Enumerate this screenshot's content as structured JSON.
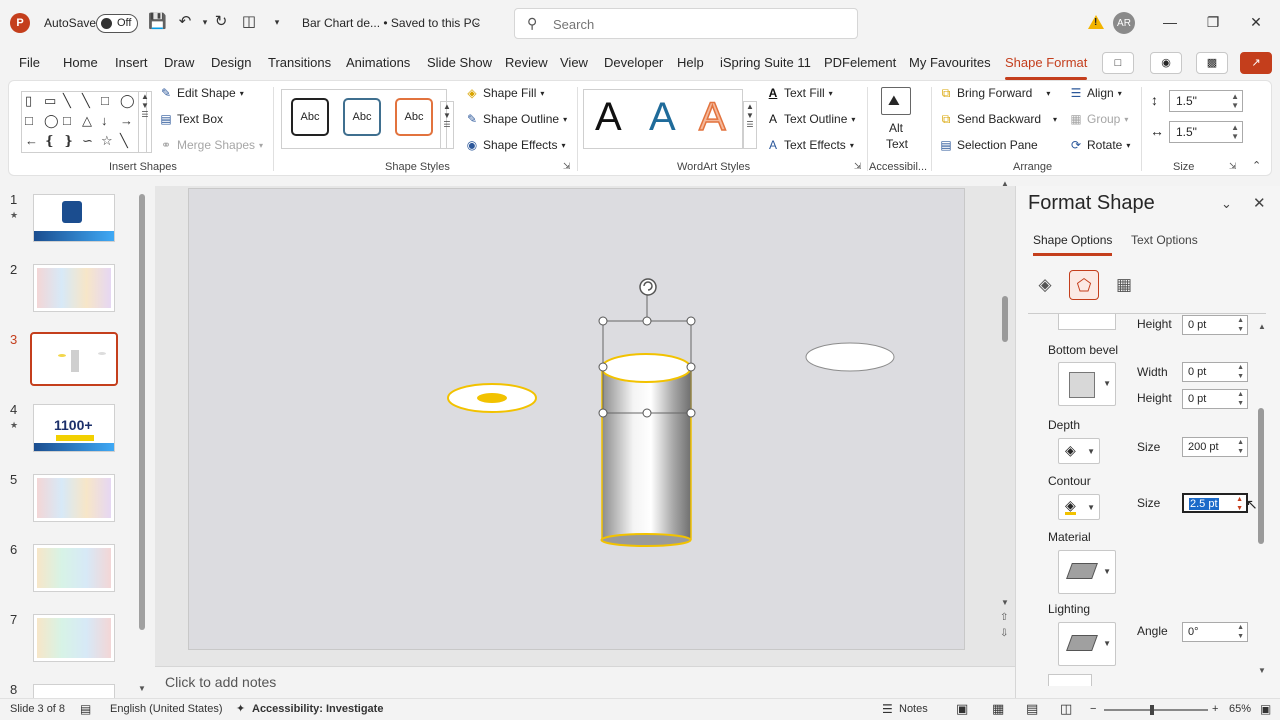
{
  "app": {
    "autosave_label": "AutoSave",
    "autosave_state": "Off",
    "doc_title": "Bar Chart de... • Saved to this PC",
    "search_placeholder": "Search",
    "user_initials": "AR",
    "logo_letter": "P",
    "accent_color": "#c43e1c"
  },
  "menu": {
    "tabs": [
      "File",
      "Home",
      "Insert",
      "Draw",
      "Design",
      "Transitions",
      "Animations",
      "Slide Show",
      "Review",
      "View",
      "Developer",
      "Help",
      "iSpring Suite 11",
      "PDFelement",
      "My Favourites",
      "Shape Format"
    ],
    "active": "Shape Format"
  },
  "ribbon": {
    "insert_shapes": {
      "label": "Insert Shapes",
      "edit_shape": "Edit Shape",
      "text_box": "Text Box",
      "merge_shapes": "Merge Shapes"
    },
    "shape_styles": {
      "label": "Shape Styles",
      "preview_text": "Abc",
      "shape_fill": "Shape Fill",
      "shape_outline": "Shape Outline",
      "shape_effects": "Shape Effects"
    },
    "wordart": {
      "label": "WordArt Styles",
      "letter": "A",
      "text_fill": "Text Fill",
      "text_outline": "Text Outline",
      "text_effects": "Text Effects"
    },
    "accessibility": {
      "label": "Accessibil...",
      "alt_text_line1": "Alt",
      "alt_text_line2": "Text"
    },
    "arrange": {
      "label": "Arrange",
      "bring_forward": "Bring Forward",
      "send_backward": "Send Backward",
      "selection_pane": "Selection Pane",
      "align": "Align",
      "group": "Group",
      "rotate": "Rotate"
    },
    "size": {
      "label": "Size",
      "height": "1.5\"",
      "width": "1.5\""
    }
  },
  "slides": [
    {
      "num": "1",
      "star": true
    },
    {
      "num": "2",
      "star": false
    },
    {
      "num": "3",
      "star": false,
      "active": true
    },
    {
      "num": "4",
      "star": true,
      "text": "1100+"
    },
    {
      "num": "5",
      "star": false
    },
    {
      "num": "6",
      "star": false
    },
    {
      "num": "7",
      "star": false
    },
    {
      "num": "8",
      "star": false
    }
  ],
  "notes_placeholder": "Click to add notes",
  "format_pane": {
    "title": "Format Shape",
    "tab_shape": "Shape Options",
    "tab_text": "Text Options",
    "height_label": "Height",
    "width_label": "Width",
    "top_height_value": "0 pt",
    "bottom_bevel_label": "Bottom bevel",
    "bottom_width_value": "0 pt",
    "bottom_height_value": "0 pt",
    "depth_label": "Depth",
    "size_label": "Size",
    "depth_size_value": "200 pt",
    "contour_label": "Contour",
    "contour_size_value": "2.5 pt",
    "material_label": "Material",
    "lighting_label": "Lighting",
    "angle_label": "Angle",
    "angle_value": "0°"
  },
  "status": {
    "slide_info": "Slide 3 of 8",
    "language": "English (United States)",
    "accessibility": "Accessibility: Investigate",
    "notes": "Notes",
    "zoom": "65%"
  }
}
